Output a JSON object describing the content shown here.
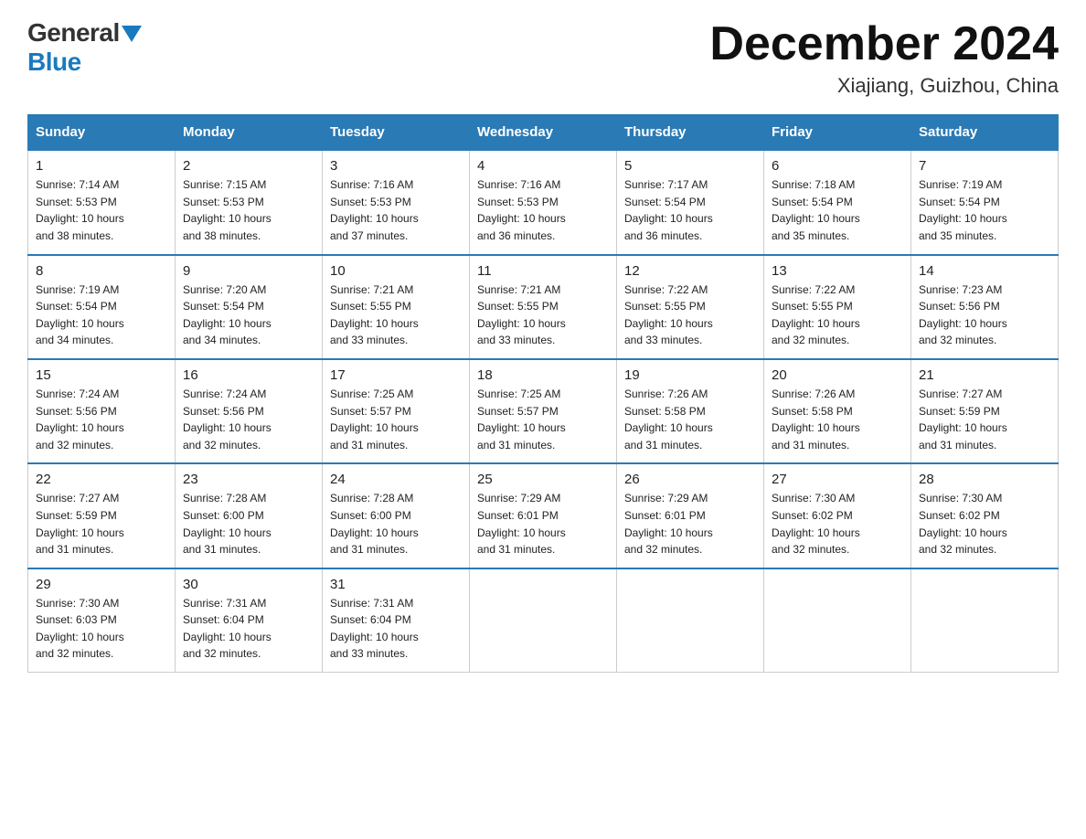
{
  "header": {
    "title": "December 2024",
    "subtitle": "Xiajiang, Guizhou, China",
    "logo_general": "General",
    "logo_blue": "Blue"
  },
  "weekdays": [
    "Sunday",
    "Monday",
    "Tuesday",
    "Wednesday",
    "Thursday",
    "Friday",
    "Saturday"
  ],
  "weeks": [
    [
      {
        "day": "1",
        "sunrise": "7:14 AM",
        "sunset": "5:53 PM",
        "daylight": "10 hours and 38 minutes."
      },
      {
        "day": "2",
        "sunrise": "7:15 AM",
        "sunset": "5:53 PM",
        "daylight": "10 hours and 38 minutes."
      },
      {
        "day": "3",
        "sunrise": "7:16 AM",
        "sunset": "5:53 PM",
        "daylight": "10 hours and 37 minutes."
      },
      {
        "day": "4",
        "sunrise": "7:16 AM",
        "sunset": "5:53 PM",
        "daylight": "10 hours and 36 minutes."
      },
      {
        "day": "5",
        "sunrise": "7:17 AM",
        "sunset": "5:54 PM",
        "daylight": "10 hours and 36 minutes."
      },
      {
        "day": "6",
        "sunrise": "7:18 AM",
        "sunset": "5:54 PM",
        "daylight": "10 hours and 35 minutes."
      },
      {
        "day": "7",
        "sunrise": "7:19 AM",
        "sunset": "5:54 PM",
        "daylight": "10 hours and 35 minutes."
      }
    ],
    [
      {
        "day": "8",
        "sunrise": "7:19 AM",
        "sunset": "5:54 PM",
        "daylight": "10 hours and 34 minutes."
      },
      {
        "day": "9",
        "sunrise": "7:20 AM",
        "sunset": "5:54 PM",
        "daylight": "10 hours and 34 minutes."
      },
      {
        "day": "10",
        "sunrise": "7:21 AM",
        "sunset": "5:55 PM",
        "daylight": "10 hours and 33 minutes."
      },
      {
        "day": "11",
        "sunrise": "7:21 AM",
        "sunset": "5:55 PM",
        "daylight": "10 hours and 33 minutes."
      },
      {
        "day": "12",
        "sunrise": "7:22 AM",
        "sunset": "5:55 PM",
        "daylight": "10 hours and 33 minutes."
      },
      {
        "day": "13",
        "sunrise": "7:22 AM",
        "sunset": "5:55 PM",
        "daylight": "10 hours and 32 minutes."
      },
      {
        "day": "14",
        "sunrise": "7:23 AM",
        "sunset": "5:56 PM",
        "daylight": "10 hours and 32 minutes."
      }
    ],
    [
      {
        "day": "15",
        "sunrise": "7:24 AM",
        "sunset": "5:56 PM",
        "daylight": "10 hours and 32 minutes."
      },
      {
        "day": "16",
        "sunrise": "7:24 AM",
        "sunset": "5:56 PM",
        "daylight": "10 hours and 32 minutes."
      },
      {
        "day": "17",
        "sunrise": "7:25 AM",
        "sunset": "5:57 PM",
        "daylight": "10 hours and 31 minutes."
      },
      {
        "day": "18",
        "sunrise": "7:25 AM",
        "sunset": "5:57 PM",
        "daylight": "10 hours and 31 minutes."
      },
      {
        "day": "19",
        "sunrise": "7:26 AM",
        "sunset": "5:58 PM",
        "daylight": "10 hours and 31 minutes."
      },
      {
        "day": "20",
        "sunrise": "7:26 AM",
        "sunset": "5:58 PM",
        "daylight": "10 hours and 31 minutes."
      },
      {
        "day": "21",
        "sunrise": "7:27 AM",
        "sunset": "5:59 PM",
        "daylight": "10 hours and 31 minutes."
      }
    ],
    [
      {
        "day": "22",
        "sunrise": "7:27 AM",
        "sunset": "5:59 PM",
        "daylight": "10 hours and 31 minutes."
      },
      {
        "day": "23",
        "sunrise": "7:28 AM",
        "sunset": "6:00 PM",
        "daylight": "10 hours and 31 minutes."
      },
      {
        "day": "24",
        "sunrise": "7:28 AM",
        "sunset": "6:00 PM",
        "daylight": "10 hours and 31 minutes."
      },
      {
        "day": "25",
        "sunrise": "7:29 AM",
        "sunset": "6:01 PM",
        "daylight": "10 hours and 31 minutes."
      },
      {
        "day": "26",
        "sunrise": "7:29 AM",
        "sunset": "6:01 PM",
        "daylight": "10 hours and 32 minutes."
      },
      {
        "day": "27",
        "sunrise": "7:30 AM",
        "sunset": "6:02 PM",
        "daylight": "10 hours and 32 minutes."
      },
      {
        "day": "28",
        "sunrise": "7:30 AM",
        "sunset": "6:02 PM",
        "daylight": "10 hours and 32 minutes."
      }
    ],
    [
      {
        "day": "29",
        "sunrise": "7:30 AM",
        "sunset": "6:03 PM",
        "daylight": "10 hours and 32 minutes."
      },
      {
        "day": "30",
        "sunrise": "7:31 AM",
        "sunset": "6:04 PM",
        "daylight": "10 hours and 32 minutes."
      },
      {
        "day": "31",
        "sunrise": "7:31 AM",
        "sunset": "6:04 PM",
        "daylight": "10 hours and 33 minutes."
      },
      null,
      null,
      null,
      null
    ]
  ],
  "labels": {
    "sunrise": "Sunrise:",
    "sunset": "Sunset:",
    "daylight": "Daylight:"
  }
}
